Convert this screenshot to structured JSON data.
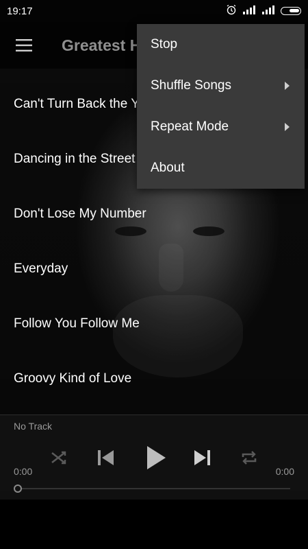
{
  "status_bar": {
    "time": "19:17"
  },
  "app_bar": {
    "title": "Greatest Hits"
  },
  "songs": [
    {
      "title": "Can't Turn Back the Years"
    },
    {
      "title": "Dancing in the Street"
    },
    {
      "title": "Don't Lose My Number"
    },
    {
      "title": "Everyday"
    },
    {
      "title": "Follow You Follow Me"
    },
    {
      "title": "Groovy Kind of Love"
    }
  ],
  "player": {
    "track": "No Track",
    "elapsed": "0:00",
    "duration": "0:00",
    "progress": 0
  },
  "overflow_menu": {
    "items": [
      {
        "label": "Stop"
      },
      {
        "label": "Shuffle Songs"
      },
      {
        "label": "Repeat Mode"
      },
      {
        "label": "About"
      }
    ]
  },
  "icons": {
    "menu": "hamburger-icon",
    "shuffle": "shuffle-icon",
    "previous": "skip-previous-icon",
    "play": "play-icon",
    "next": "skip-next-icon",
    "repeat": "repeat-icon"
  }
}
